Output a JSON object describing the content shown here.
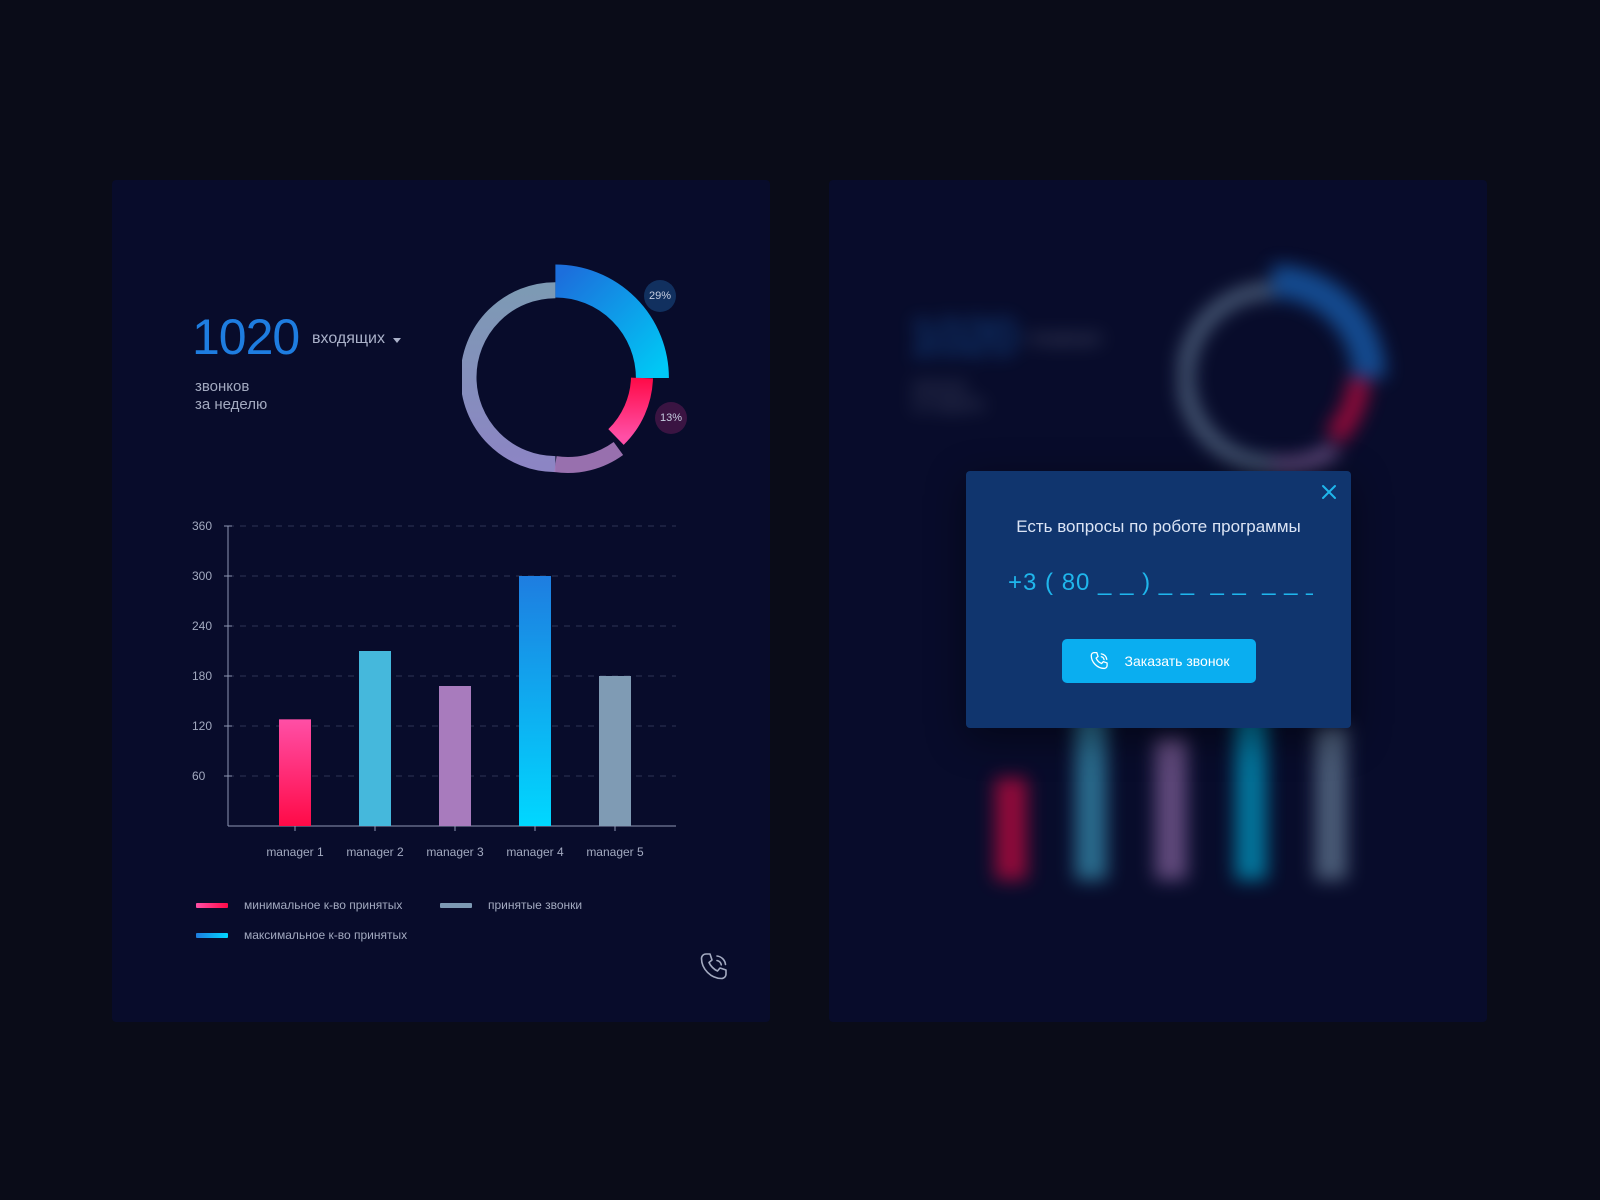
{
  "summary": {
    "calls_count": "1020",
    "type_dropdown": "входящих",
    "subtitle_line1": "звонков",
    "subtitle_line2": "за неделю"
  },
  "donut": {
    "badges": [
      "29%",
      "13%"
    ]
  },
  "legend": {
    "items": [
      {
        "label": "минимальное к-во принятых",
        "color_start": "#ff4fa6",
        "color_end": "#ff0a47"
      },
      {
        "label": "принятые звонки",
        "color_start": "#7d9ab4",
        "color_end": "#7d9ab4"
      },
      {
        "label": "максимальное к-во принятых",
        "color_start": "#1e7de0",
        "color_end": "#00d8ff"
      }
    ]
  },
  "chart_data": {
    "type": "bar",
    "categories": [
      "manager 1",
      "manager 2",
      "manager  3",
      "manager 4",
      "manager 5"
    ],
    "values": [
      128,
      210,
      168,
      300,
      180
    ],
    "ylim": [
      0,
      360
    ],
    "yticks": [
      60,
      120,
      180,
      240,
      300,
      360
    ],
    "grid": true,
    "bar_colors": [
      [
        "#ff4fa6",
        "#ff0a47"
      ],
      [
        "#45b8dc",
        "#45b8dc"
      ],
      [
        "#a87bbd",
        "#a87bbd"
      ],
      [
        "#1e7de0",
        "#00d8ff"
      ],
      [
        "#7f9bb4",
        "#7f9bb4"
      ]
    ]
  },
  "modal": {
    "title": "Есть вопросы по роботе программы",
    "phone_placeholder": "+3 ( 80 _ _ ) _ _  _ _  _ _ _",
    "button_label": "Заказать звонок"
  },
  "colors": {
    "accent": "#1e7de0",
    "background": "#0a0c18",
    "panel": "#080c2b",
    "modal": "#10356e",
    "button": "#0aaef0"
  }
}
